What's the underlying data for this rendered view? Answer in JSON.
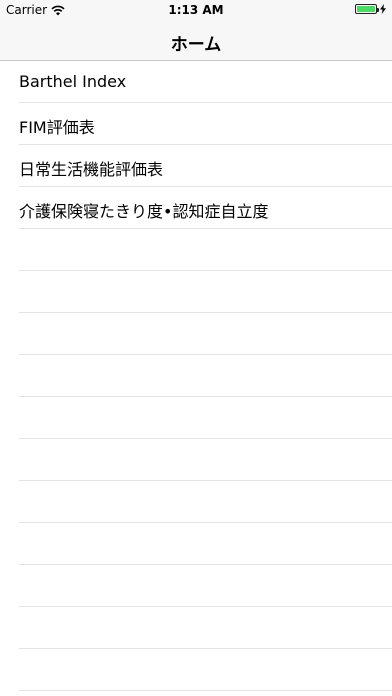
{
  "status_bar": {
    "carrier": "Carrier",
    "time": "1:13 AM",
    "battery_level": 1.0,
    "battery_color": "#4cd964",
    "icons": [
      "wifi-icon",
      "battery-icon",
      "charging-bolt-icon"
    ]
  },
  "nav": {
    "title": "ホーム"
  },
  "list": {
    "items": [
      {
        "label": "Barthel Index"
      },
      {
        "label": "FIM評価表"
      },
      {
        "label": "日常生活機能評価表"
      },
      {
        "label": "介護保険寝たきり度•認知症自立度"
      }
    ]
  }
}
